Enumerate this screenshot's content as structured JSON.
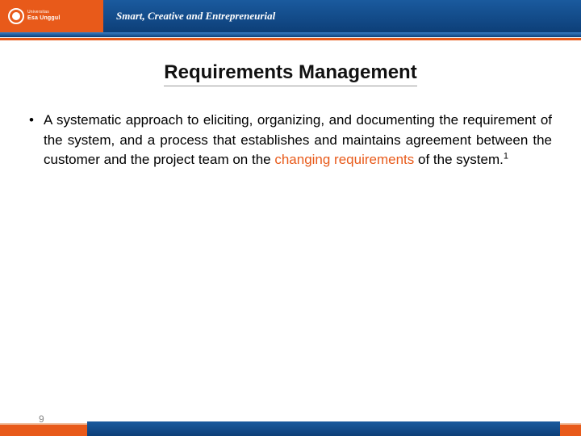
{
  "header": {
    "university_prefix": "Universitas",
    "university_name": "Esa Unggul",
    "tagline": "Smart, Creative and Entrepreneurial"
  },
  "title": "Requirements Management",
  "content": {
    "bullet_prefix": "A systematic approach to eliciting, organizing, and documenting the requirement of the system, and a process that establishes and maintains agreement between the customer and the project team on the ",
    "bullet_highlight": "changing requirements",
    "bullet_suffix": " of the system.",
    "footnote_mark": "1"
  },
  "footer": {
    "page_number": "9"
  }
}
